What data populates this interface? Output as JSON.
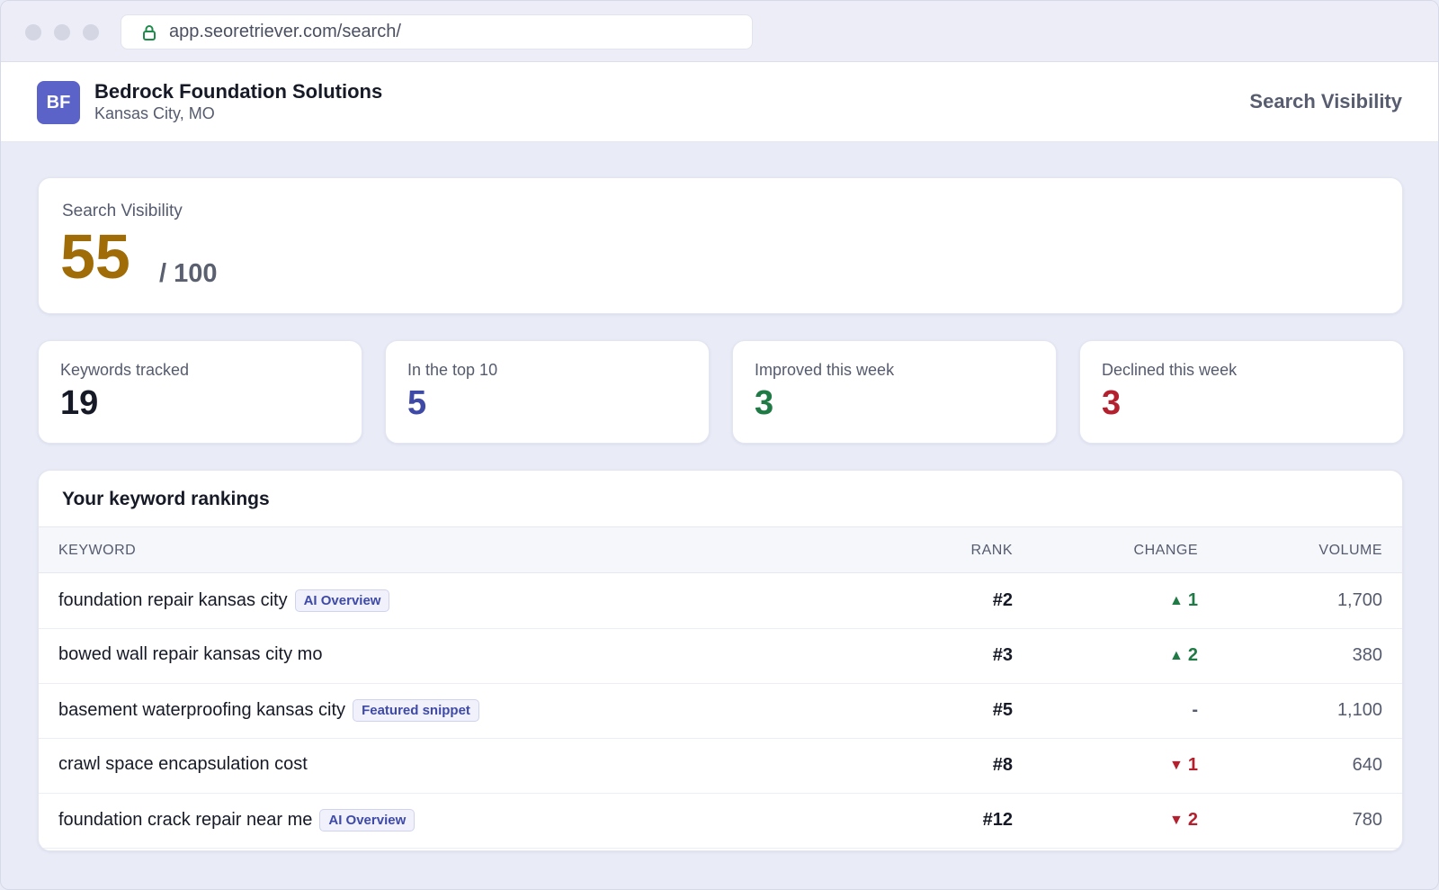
{
  "browser": {
    "url": "app.seoretriever.com/search/"
  },
  "header": {
    "avatar_initials": "BF",
    "business_name": "Bedrock Foundation Solutions",
    "location": "Kansas City, MO",
    "page_title": "Search Visibility"
  },
  "visibility": {
    "label": "Search Visibility",
    "score": "55",
    "max": "/ 100",
    "score_color": "#a06c07"
  },
  "stats": [
    {
      "label": "Keywords tracked",
      "value": "19",
      "color": "#161a26"
    },
    {
      "label": "In the top 10",
      "value": "5",
      "color": "#3f4aa6"
    },
    {
      "label": "Improved this week",
      "value": "3",
      "color": "#1f7a45"
    },
    {
      "label": "Declined this week",
      "value": "3",
      "color": "#b3202e"
    }
  ],
  "rankings": {
    "title": "Your keyword rankings",
    "columns": {
      "keyword": "KEYWORD",
      "rank": "RANK",
      "change": "CHANGE",
      "volume": "VOLUME"
    },
    "rows": [
      {
        "keyword": "foundation repair kansas city",
        "badge": "AI Overview",
        "rank": "#2",
        "change": "1",
        "direction": "up",
        "volume": "1,700"
      },
      {
        "keyword": "bowed wall repair kansas city mo",
        "badge": "",
        "rank": "#3",
        "change": "2",
        "direction": "up",
        "volume": "380"
      },
      {
        "keyword": "basement waterproofing kansas city",
        "badge": "Featured snippet",
        "rank": "#5",
        "change": "-",
        "direction": "flat",
        "volume": "1,100"
      },
      {
        "keyword": "crawl space encapsulation cost",
        "badge": "",
        "rank": "#8",
        "change": "1",
        "direction": "down",
        "volume": "640"
      },
      {
        "keyword": "foundation crack repair near me",
        "badge": "AI Overview",
        "rank": "#12",
        "change": "2",
        "direction": "down",
        "volume": "780"
      }
    ]
  },
  "icons": {
    "lock": "lock-icon",
    "up": "▲",
    "down": "▼"
  }
}
